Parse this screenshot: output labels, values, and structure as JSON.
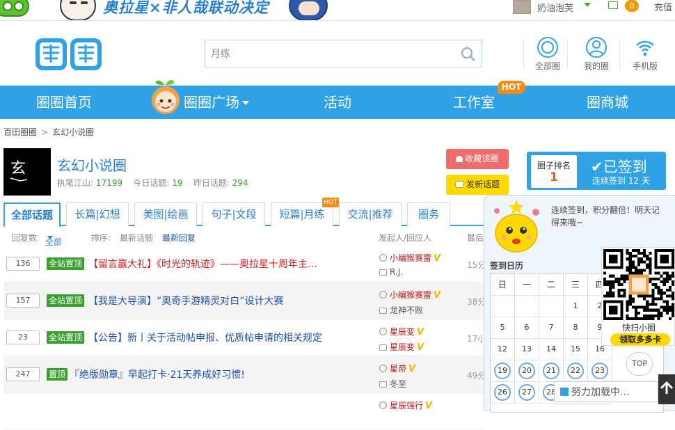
{
  "topbar": {
    "banner_text": "奥拉星×非人哉联动决定",
    "username": "奶油泡芙",
    "mail_count": "0",
    "recharge": "充值"
  },
  "header": {
    "logo_text": "圈圈",
    "search": {
      "value": "月练"
    },
    "nav": [
      {
        "label": "全部圈",
        "icon": "circle-target-icon"
      },
      {
        "label": "我的圈",
        "icon": "user-icon"
      },
      {
        "label": "手机版",
        "icon": "wifi-icon"
      }
    ]
  },
  "navbar": {
    "items": [
      "圈圈首页",
      "圈圈广场",
      "活动",
      "工作室",
      "圈商城"
    ],
    "hot": "HOT"
  },
  "breadcrumb": [
    "百田圈圈",
    "玄幻小说圈"
  ],
  "group": {
    "avatar_text": "玄",
    "name": "玄幻小说圈",
    "stats": {
      "owner_label": "执笔江山:",
      "owner_value": "17199",
      "today_label": "今日话题:",
      "today_value": "19",
      "yesterday_label": "昨日话题:",
      "yesterday_value": "294"
    },
    "fav_button": "收藏该圈",
    "post_button": "发新话题"
  },
  "rank": {
    "label": "圈子排名",
    "value": "1",
    "signed": "已签到",
    "streak": "连续签到 12 天"
  },
  "tabs": [
    "全部话题",
    "长篇|幻想",
    "美图|绘画",
    "句子|文段",
    "短篇|月练",
    "交流|推荐",
    "圈务"
  ],
  "tab_hot": "HOT",
  "list_header": {
    "replies": "回复数",
    "filter": "全部",
    "sort_label": "排序:",
    "sort_latest_topic": "最新话题",
    "sort_latest_reply": "最新回复",
    "poster": "发起人/回应人",
    "last": "最后"
  },
  "topics": [
    {
      "count": "136",
      "badge": "全站置顶",
      "title": "【留言赢大礼】《时光的轨迹》——奥拉星十周年主…",
      "red": true,
      "u1": "小编猴赛雷",
      "u1_vip": "V",
      "u2": "R.J.",
      "u2_red": false,
      "u2_vip": "",
      "time": "15分"
    },
    {
      "count": "157",
      "badge": "全站置顶",
      "title": "【我是大导演】“奥奇手游精灵对白”设计大赛",
      "red": false,
      "u1": "小编猴赛雷",
      "u1_vip": "V",
      "u2": "龙神不败",
      "u2_red": false,
      "u2_vip": "",
      "time": "38分"
    },
    {
      "count": "23",
      "badge": "全站置顶",
      "title": "【公告】新丨关于活动帖申报、优质帖申请的相关规定",
      "red": false,
      "u1": "星辰变",
      "u1_vip": "V",
      "u2": "星辰变",
      "u2_red": true,
      "u2_vip": "V",
      "time": "17小"
    },
    {
      "count": "247",
      "badge": "置顶",
      "title": "『绝版勋章』早起打卡·21天养成好习惯!",
      "red": false,
      "u1": "星帝",
      "u1_vip": "V",
      "u2": "冬至",
      "u2_red": false,
      "u2_vip": "",
      "time": "49分"
    },
    {
      "count": "",
      "badge": "",
      "title": "",
      "red": false,
      "u1": "星辰强行",
      "u1_vip": "V",
      "u2": "",
      "u2_red": false,
      "u2_vip": "",
      "time": ""
    }
  ],
  "checkin": {
    "message": "连续签到，积分翻倍！明天记得来哦~",
    "calendar_title": "签到日历",
    "weekdays": [
      "日",
      "一",
      "二",
      "三",
      "四"
    ],
    "weeks": [
      [
        "",
        "",
        "",
        "1",
        "2"
      ],
      [
        "5",
        "6",
        "7",
        "8",
        "9"
      ],
      [
        "12",
        "13",
        "14",
        "15",
        "16"
      ],
      [
        "19",
        "20",
        "21",
        "22",
        "23"
      ],
      [
        "26",
        "27",
        "28",
        "",
        ""
      ]
    ],
    "signed_days": [
      "19",
      "20",
      "21",
      "22",
      "23",
      "26",
      "27",
      "28"
    ]
  },
  "qr": {
    "label": "快扫小圈",
    "button": "领取多多卡"
  },
  "top_button": "TOP",
  "loading": "努力加载中…"
}
